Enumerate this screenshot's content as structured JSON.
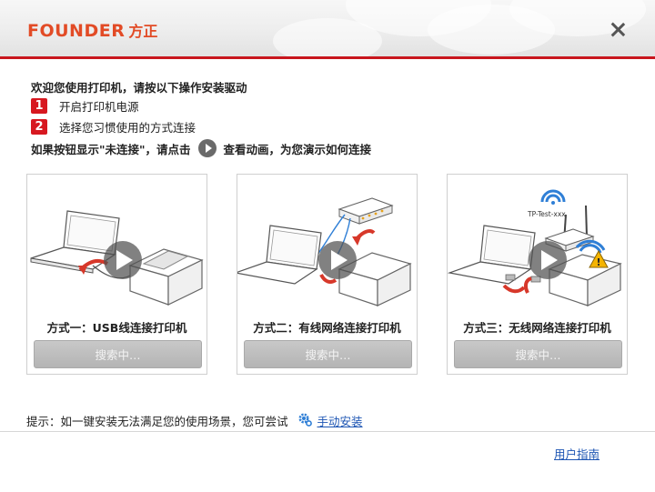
{
  "header": {
    "logo_latin": "FOUNDER",
    "logo_cjk": "方正",
    "brand_color": "#e24b26",
    "accent_line_color": "#c8161d"
  },
  "intro": {
    "welcome": "欢迎您使用打印机，请按以下操作安装驱动",
    "steps": [
      {
        "num": "1",
        "text": "开启打印机电源"
      },
      {
        "num": "2",
        "text": "选择您习惯使用的方式连接"
      }
    ],
    "hint_prefix": "如果按钮显示\"未连接\"，请点击",
    "hint_suffix": "查看动画，为您演示如何连接"
  },
  "cards": [
    {
      "title": "方式一：USB线连接打印机",
      "button": "搜索中…",
      "icon": "usb-connection-illustration"
    },
    {
      "title": "方式二：有线网络连接打印机",
      "button": "搜索中…",
      "icon": "wired-network-illustration"
    },
    {
      "title": "方式三：无线网络连接打印机",
      "button": "搜索中…",
      "icon": "wireless-network-illustration",
      "ssid": "TP-Test-xxx"
    }
  ],
  "tip": {
    "text": "提示：如一键安装无法满足您的使用场景，您可尝试",
    "manual_link": "手动安装"
  },
  "footer": {
    "user_guide": "用户指南"
  }
}
